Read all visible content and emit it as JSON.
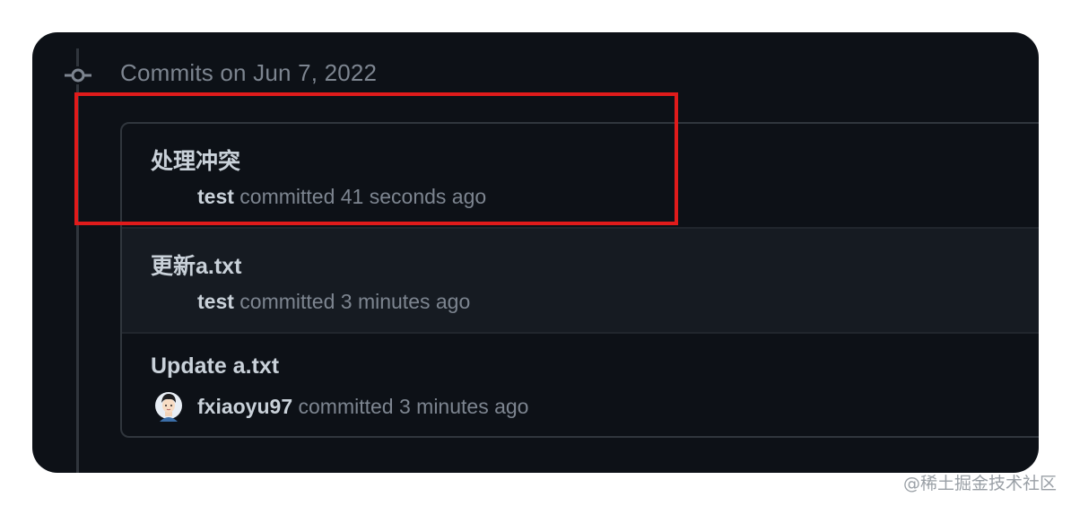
{
  "group": {
    "title": "Commits on Jun 7, 2022",
    "icon": "git-commit-icon"
  },
  "commits": [
    {
      "title": "处理冲突",
      "author": "test",
      "meta": "committed 41 seconds ago",
      "avatar": null
    },
    {
      "title": "更新a.txt",
      "author": "test",
      "meta": "committed 3 minutes ago",
      "avatar": null
    },
    {
      "title": "Update a.txt",
      "author": "fxiaoyu97",
      "meta": "committed 3 minutes ago",
      "avatar": "user-avatar-icon"
    }
  ],
  "annotation": {
    "color": "#e01b1b"
  },
  "watermark": "@稀土掘金技术社区",
  "colors": {
    "background": "#0d1117",
    "border": "#30363d",
    "text_primary": "#c9d1d9",
    "text_muted": "#7d8590"
  }
}
